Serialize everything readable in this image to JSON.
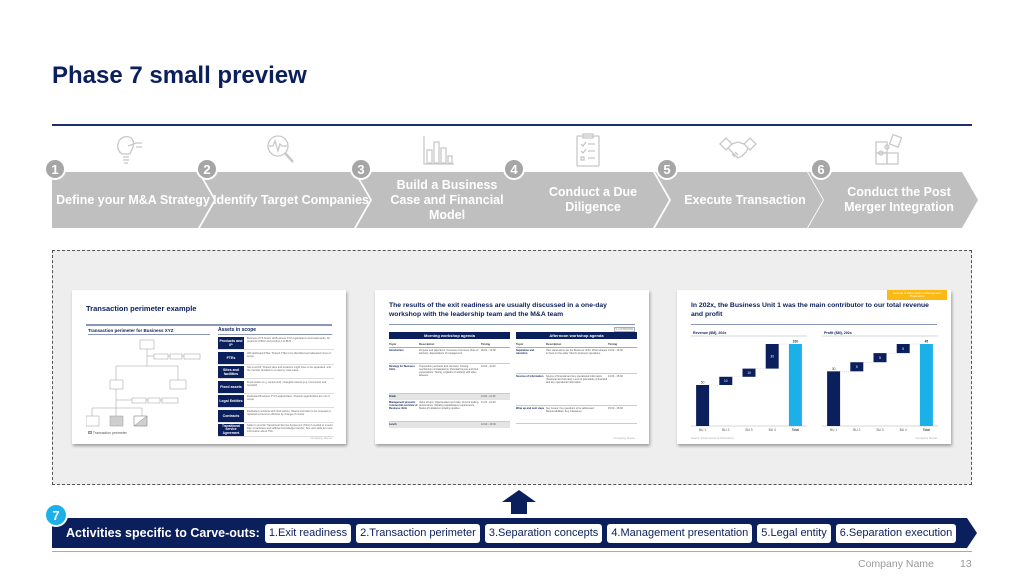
{
  "page": {
    "title": "Phase 7 small preview",
    "footer_company": "Company Name",
    "page_number": "13"
  },
  "colors": {
    "navy": "#0b1f5c",
    "chevron_gray": "#bfbfbf",
    "accent_cyan": "#1bb0e8",
    "tag_yellow": "#fdb913"
  },
  "steps": [
    {
      "number": "1",
      "label": "Define your M&A Strategy",
      "icon": "lightbulb-plug-icon"
    },
    {
      "number": "2",
      "label": "Identify Target Companies",
      "icon": "magnifier-pulse-icon"
    },
    {
      "number": "3",
      "label": "Build a Business Case and Financial Model",
      "icon": "bar-chart-icon"
    },
    {
      "number": "4",
      "label": "Conduct a Due Diligence",
      "icon": "clipboard-checklist-icon"
    },
    {
      "number": "5",
      "label": "Execute Transaction",
      "icon": "handshake-icon"
    },
    {
      "number": "6",
      "label": "Conduct the Post Merger Integration",
      "icon": "puzzle-icon"
    }
  ],
  "previews": [
    {
      "title": "Transaction perimeter example",
      "left_header": "Transaction perimeter for Business XYZ",
      "right_header": "Assets in scope",
      "legend": "Transaction perimeter",
      "org_nodes": [
        "Group Company",
        "Finance",
        "IT",
        "Procurement",
        "UK",
        "Europe",
        "Finance",
        "IT",
        "Procurement",
        "BU 1",
        "BU 2",
        "BU 3"
      ],
      "asset_rows": [
        {
          "label": "Products and IP",
          "text": "Business XYZ brand; All Business XYZ registrations and trademarks; All products of BU2 and product A of BU3"
        },
        {
          "label": "FTEs",
          "text": "300 dedicated FTEs; Shared FTEs to be identified and allocated in/out of scope"
        },
        {
          "label": "Sites and facilities",
          "text": "Site A and B; Shared sites and locations might have to be separated, and the transfer decided on a case by case basis"
        },
        {
          "label": "Fixed assets",
          "text": "Fixed assets (e.g. equipment), intangible assets (e.g. know-how) and Goodwill"
        },
        {
          "label": "Legal Entities",
          "text": "Dedicated Business XYZ Legal Entities; Shared Legal Entities are out of scope"
        },
        {
          "label": "Contracts",
          "text": "Dedicated contracts with third parties; Shared contracts to be renewed or replaced to become effective by change of control"
        },
        {
          "label": "Transitional Service Agreement",
          "text": "Seller to provide Transitional Service Agreement (TSA) if needed to ensure Day 1 readiness and sufficient knowledge transfer; See next slide for more information about TSA"
        }
      ],
      "footer": "Company Name"
    },
    {
      "title": "The results of the exit readiness are usually discussed in a one-day workshop with the leadership team and the M&A team",
      "tag": "ILLUSTRATIVE",
      "morning": {
        "header": "Morning workshop agenda",
        "columns": [
          "Topic",
          "Description",
          "Timing"
        ],
        "rows": [
          {
            "topic": "Introduction",
            "desc": "Purpose and objectives; Overview of process; Role of advisors; Expectations of management",
            "time": "09:00 - 10:00"
          },
          {
            "topic": "Strategy for Business Units",
            "desc": "Transaction perimeter and structure; Closing mechanism considerations; Potential buyers and their expectations; Timing; Logistics of working with other advisors",
            "time": "10:00 - 11:00"
          },
          {
            "topic": "Break",
            "desc": "",
            "time": "11:00 - 11:15"
          },
          {
            "topic": "Management presents commercial overview of Business Units",
            "desc": "Value drivers; Opportunities and risks; Current trading performance; Working capital/capex requirements; Status of initiatives including upsides",
            "time": "11:15 - 12:00"
          },
          {
            "topic": "Lunch",
            "desc": "",
            "time": "12:00 - 13:00"
          }
        ]
      },
      "afternoon": {
        "header": "Afternoon workshop agenda",
        "columns": [
          "Topic",
          "Description",
          "Timing"
        ],
        "rows": [
          {
            "topic": "Separation and transition",
            "desc": "How stand-alone are the Business Units; What reliance is there on the wider Client's business operations",
            "time": "13:00 - 14:00"
          },
          {
            "topic": "Sources of information",
            "desc": "Source of financial and key operational information (historical and forecast); Level of granularity of financial and key operational information",
            "time": "14:00 - 15:00"
          },
          {
            "topic": "Wrap up and next steps",
            "desc": "Key issues; Key questions to be addressed; Responsibilities; Key milestones",
            "time": "15:00 - 16:00"
          }
        ]
      },
      "footer": "Company Name"
    },
    {
      "title": "In 202x, the Business Unit 1 was the main contributor to our total revenue and profit",
      "tag": "Example of slides used in a Management Presentation",
      "source": "Source: [Insert source of information]",
      "footer": "Company Name"
    }
  ],
  "chart_data": [
    {
      "type": "bar",
      "subtype": "waterfall",
      "title": "Revenue ($M), 202x",
      "categories": [
        "BU 1",
        "BU 2",
        "BU 3",
        "BU 4",
        "Total"
      ],
      "values": [
        50,
        10,
        10,
        30,
        100
      ],
      "ylim": [
        0,
        100
      ]
    },
    {
      "type": "bar",
      "subtype": "waterfall",
      "title": "Profit ($M), 202x",
      "categories": [
        "BU 1",
        "BU 2",
        "BU 3",
        "BU 4",
        "Total"
      ],
      "values": [
        30,
        5,
        5,
        5,
        45
      ],
      "ylim": [
        0,
        45
      ]
    }
  ],
  "carveout": {
    "number": "7",
    "label": "Activities specific to Carve-outs:",
    "activities": [
      "1.Exit readiness",
      "2.Transaction perimeter",
      "3.Separation concepts",
      "4.Management presentation",
      "5.Legal entity",
      "6.Separation execution"
    ]
  }
}
